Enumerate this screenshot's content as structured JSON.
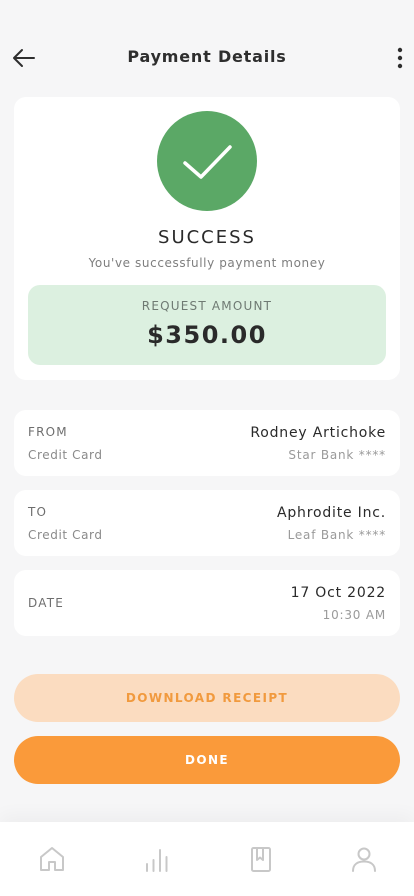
{
  "header": {
    "title": "Payment Details",
    "back_icon": "arrow-left-icon",
    "more_icon": "more-vertical-icon"
  },
  "success": {
    "icon": "check-icon",
    "title": "SUCCESS",
    "subtitle": "You've successfully payment money",
    "amount_label": "REQUEST AMOUNT",
    "amount_value": "$350.00",
    "colors": {
      "circle": "#5ba866",
      "amount_bg": "#dcf0e0"
    }
  },
  "details": {
    "from": {
      "label": "FROM",
      "sublabel": "Credit Card",
      "name": "Rodney Artichoke",
      "bank": "Star Bank ****"
    },
    "to": {
      "label": "TO",
      "sublabel": "Credit Card",
      "name": "Aphrodite Inc.",
      "bank": "Leaf Bank ****"
    },
    "date": {
      "label": "DATE",
      "date": "17 Oct 2022",
      "time": "10:30 AM"
    }
  },
  "actions": {
    "download_label": "DOWNLOAD RECEIPT",
    "done_label": "DONE",
    "colors": {
      "primary": "#fa9a3a",
      "secondary_bg": "#fbdcc0"
    }
  },
  "bottom_nav": {
    "items": [
      {
        "icon": "home-icon"
      },
      {
        "icon": "bar-chart-icon"
      },
      {
        "icon": "receipt-icon"
      },
      {
        "icon": "user-icon"
      }
    ]
  }
}
